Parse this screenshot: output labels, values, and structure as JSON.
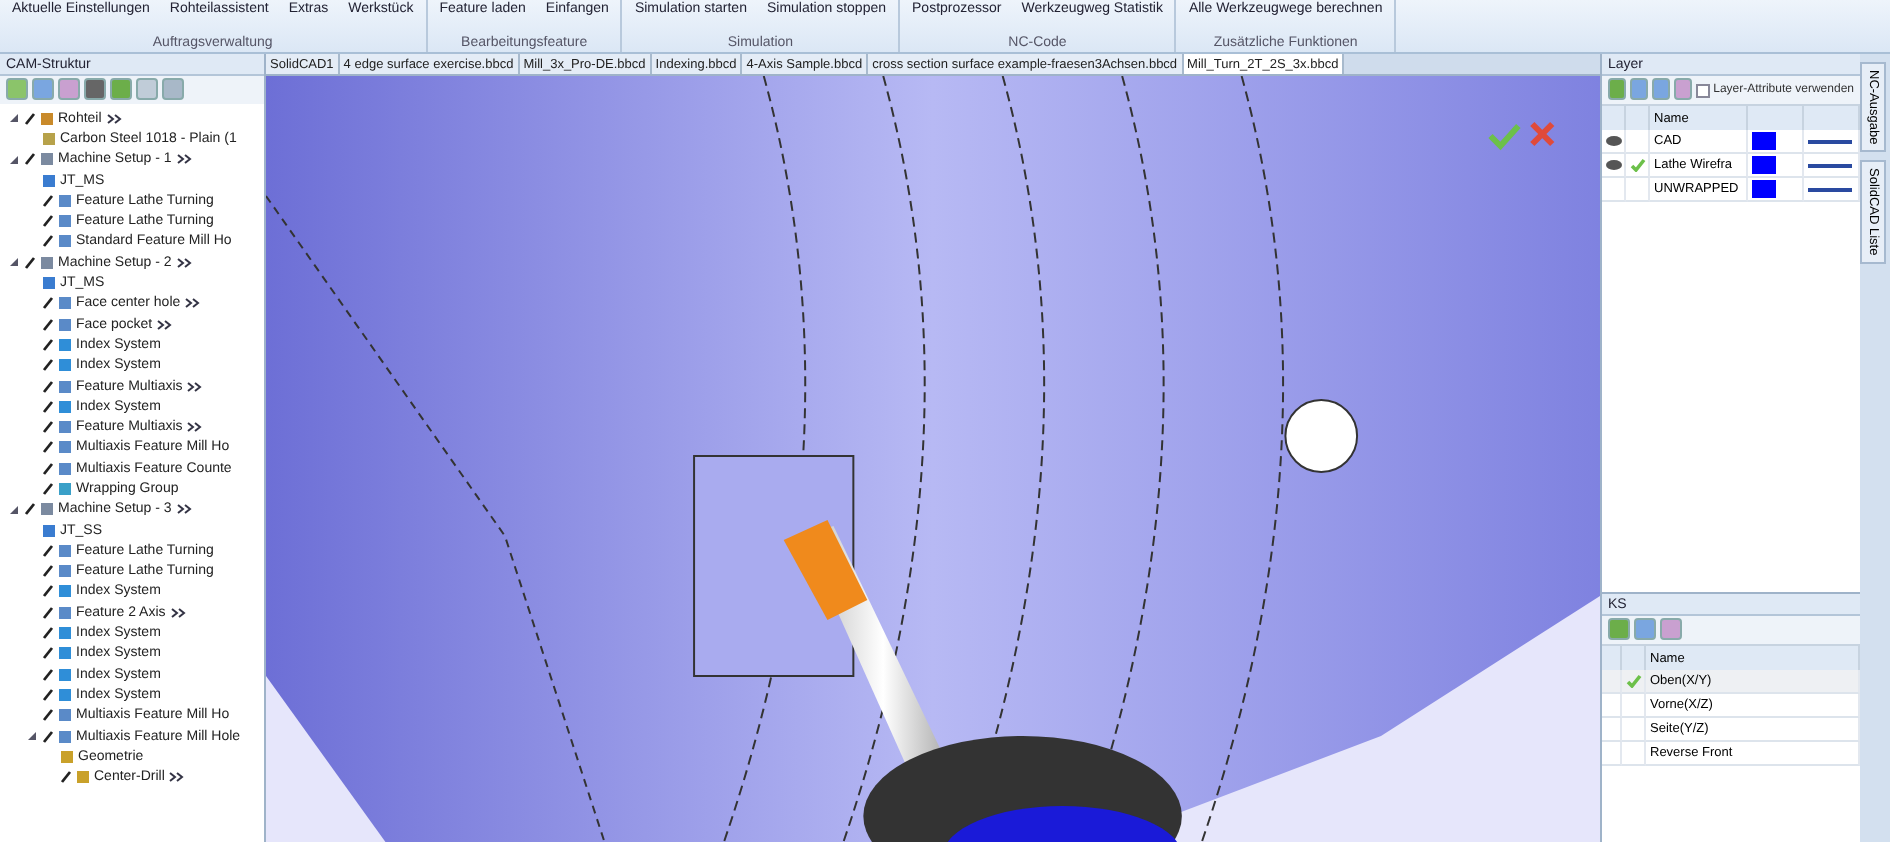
{
  "ribbon": {
    "groups": [
      {
        "label": "Auftragsverwaltung",
        "buttons": [
          "Aktuelle Einstellungen",
          "Rohteilassistent",
          "Extras",
          "Werkstück"
        ]
      },
      {
        "label": "Bearbeitungsfeature",
        "buttons": [
          "Feature laden",
          "Einfangen"
        ]
      },
      {
        "label": "Simulation",
        "buttons": [
          "Simulation starten",
          "Simulation stoppen"
        ]
      },
      {
        "label": "NC-Code",
        "buttons": [
          "Postprozessor",
          "Werkzeugweg Statistik"
        ]
      },
      {
        "label": "Zusätzliche Funktionen",
        "buttons": [
          "Alle Werkzeugwege berechnen"
        ]
      }
    ]
  },
  "cam_tree": {
    "title": "CAM-Struktur",
    "items": [
      {
        "label": "Rohteil",
        "more": true,
        "kind": "stock",
        "expanded": true,
        "children": [
          {
            "label": "Carbon Steel 1018 - Plain (1",
            "kind": "material",
            "more": false
          }
        ]
      },
      {
        "label": "Machine Setup - 1",
        "more": true,
        "kind": "setup",
        "expanded": true,
        "children": [
          {
            "label": "JT_MS",
            "kind": "coord",
            "more": false
          },
          {
            "label": "Feature Lathe Turning",
            "kind": "feature",
            "more": false
          },
          {
            "label": "Feature Lathe Turning",
            "kind": "feature",
            "more": false
          },
          {
            "label": "Standard Feature Mill Ho",
            "kind": "feature",
            "more": false
          }
        ]
      },
      {
        "label": "Machine Setup - 2",
        "more": true,
        "kind": "setup",
        "expanded": true,
        "children": [
          {
            "label": "JT_MS",
            "kind": "coord",
            "more": false
          },
          {
            "label": "Face center hole",
            "kind": "feature",
            "more": true
          },
          {
            "label": "Face pocket",
            "kind": "feature",
            "more": true
          },
          {
            "label": "Index System",
            "kind": "index",
            "more": false
          },
          {
            "label": "Index System",
            "kind": "index",
            "more": false
          },
          {
            "label": "Feature Multiaxis",
            "kind": "feature",
            "more": true
          },
          {
            "label": "Index System",
            "kind": "index",
            "more": false
          },
          {
            "label": "Feature Multiaxis",
            "kind": "feature",
            "more": true
          },
          {
            "label": "Multiaxis Feature Mill Ho",
            "kind": "feature",
            "more": false
          },
          {
            "label": "Multiaxis Feature Counte",
            "kind": "feature",
            "more": false
          },
          {
            "label": "Wrapping Group",
            "kind": "wrap",
            "more": false
          }
        ]
      },
      {
        "label": "Machine Setup - 3",
        "more": true,
        "kind": "setup",
        "expanded": true,
        "children": [
          {
            "label": "JT_SS",
            "kind": "coord",
            "more": false
          },
          {
            "label": "Feature Lathe Turning",
            "kind": "feature",
            "more": false
          },
          {
            "label": "Feature Lathe Turning",
            "kind": "feature",
            "more": false
          },
          {
            "label": "Index System",
            "kind": "index",
            "more": false
          },
          {
            "label": "Feature 2 Axis",
            "kind": "feature",
            "more": true
          },
          {
            "label": "Index System",
            "kind": "index",
            "more": false
          },
          {
            "label": "Index System",
            "kind": "index",
            "more": false
          },
          {
            "label": "Index System",
            "kind": "index",
            "more": false
          },
          {
            "label": "Index System",
            "kind": "index",
            "more": false
          },
          {
            "label": "Multiaxis Feature Mill Ho",
            "kind": "feature",
            "more": false
          },
          {
            "label": "Multiaxis Feature Mill Hole",
            "kind": "feature",
            "more": false,
            "expanded": true,
            "children": [
              {
                "label": "Geometrie",
                "kind": "geometry",
                "more": false
              },
              {
                "label": "Center-Drill",
                "kind": "tool",
                "more": true
              }
            ]
          }
        ]
      }
    ]
  },
  "doc_tabs": [
    {
      "label": "SolidCAD1",
      "selected": false
    },
    {
      "label": "4 edge surface exercise.bbcd",
      "selected": false
    },
    {
      "label": "Mill_3x_Pro-DE.bbcd",
      "selected": false
    },
    {
      "label": "Indexing.bbcd",
      "selected": false
    },
    {
      "label": "4-Axis Sample.bbcd",
      "selected": false
    },
    {
      "label": "cross section surface example-fraesen3Achsen.bbcd",
      "selected": false
    },
    {
      "label": "Mill_Turn_2T_2S_3x.bbcd",
      "selected": true
    }
  ],
  "layer_panel": {
    "title": "Layer",
    "attribute_option": {
      "label": "Layer-Attribute verwenden",
      "checked": false
    },
    "column": "Name",
    "rows": [
      {
        "name": "CAD",
        "visible": true,
        "active": false,
        "color": "#0000ff"
      },
      {
        "name": "Lathe Wirefra",
        "visible": true,
        "active": true,
        "color": "#0000ff"
      },
      {
        "name": "UNWRAPPED",
        "visible": false,
        "active": false,
        "color": "#0000ff"
      }
    ]
  },
  "side_tabs": [
    "NC-Ausgabe",
    "SolidCAD Liste"
  ],
  "ks_panel": {
    "title": "KS",
    "column": "Name",
    "rows": [
      {
        "name": "Oben(X/Y)",
        "selected": true
      },
      {
        "name": "Vorne(X/Z)",
        "selected": false
      },
      {
        "name": "Seite(Y/Z)",
        "selected": false
      },
      {
        "name": "Reverse Front",
        "selected": false
      }
    ]
  }
}
